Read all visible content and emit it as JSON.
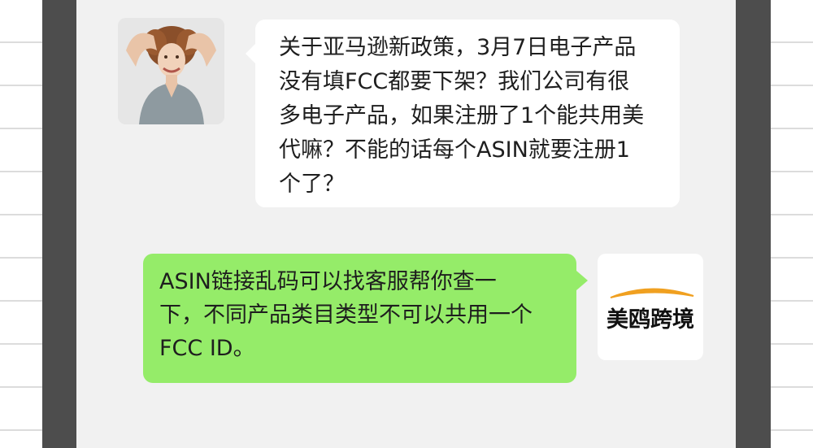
{
  "colors": {
    "page_background": "#ffffff",
    "frame": "#4d4d4d",
    "chat_background": "#f1f1f1",
    "incoming_bubble": "#ffffff",
    "outgoing_bubble": "#95ec69",
    "logo_arc": "#f0a020"
  },
  "conversation": {
    "incoming": {
      "avatar_icon": "user-photo-avatar",
      "lines": [
        "关于亚马逊新政策，3月7日电子产品",
        "没有填FCC都要下架？我们公司有很",
        "多电子产品，如果注册了1个能共用美",
        "代嘛？不能的话每个ASIN就要注册1",
        "个了？"
      ]
    },
    "outgoing": {
      "avatar_icon": "brand-logo-avatar",
      "brand_name": "美鸥跨境",
      "lines": [
        "ASIN链接乱码可以找客服帮你查一",
        "下，不同产品类目类型不可以共用一个",
        "FCC ID。"
      ]
    }
  }
}
